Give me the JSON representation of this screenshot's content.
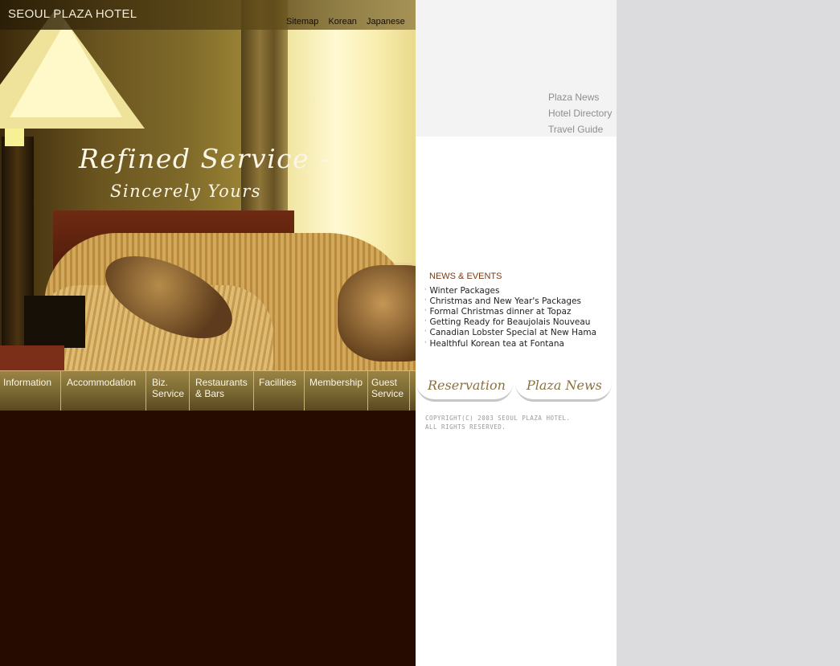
{
  "header": {
    "logo": "SEOUL PLAZA HOTEL",
    "links": [
      "Sitemap",
      "Korean",
      "Japanese"
    ]
  },
  "hero": {
    "tagline_line1": "Refined Service -",
    "tagline_line2": "Sincerely Yours"
  },
  "main_nav": [
    {
      "label": "Information"
    },
    {
      "label": "Accommodation"
    },
    {
      "label": "Biz.\nService"
    },
    {
      "label": "Restaurants\n& Bars"
    },
    {
      "label": "Facilities"
    },
    {
      "label": "Membership"
    },
    {
      "label": "Guest\nService"
    }
  ],
  "side_links": [
    "Plaza News",
    "Hotel Directory",
    "Travel Guide"
  ],
  "news": {
    "title": "NEWS & EVENTS",
    "items": [
      "Winter Packages",
      "Christmas and New Year's Packages",
      "Formal Christmas dinner at Topaz",
      "Getting Ready for Beaujolais Nouveau",
      "Canadian Lobster Special at New Hama",
      "Healthful Korean tea at Fontana"
    ]
  },
  "buttons": {
    "reservation": "Reservation",
    "plaza_news": "Plaza News"
  },
  "footer": {
    "copyright_line1": "COPYRIGHT(C) 2003 SEOUL PLAZA HOTEL.",
    "copyright_line2": "ALL RIGHTS RESERVED."
  },
  "colors": {
    "left_background": "#260b01",
    "right_background": "#dcdcdf",
    "news_title": "#7a3a12",
    "side_link": "#8e8e8e"
  }
}
